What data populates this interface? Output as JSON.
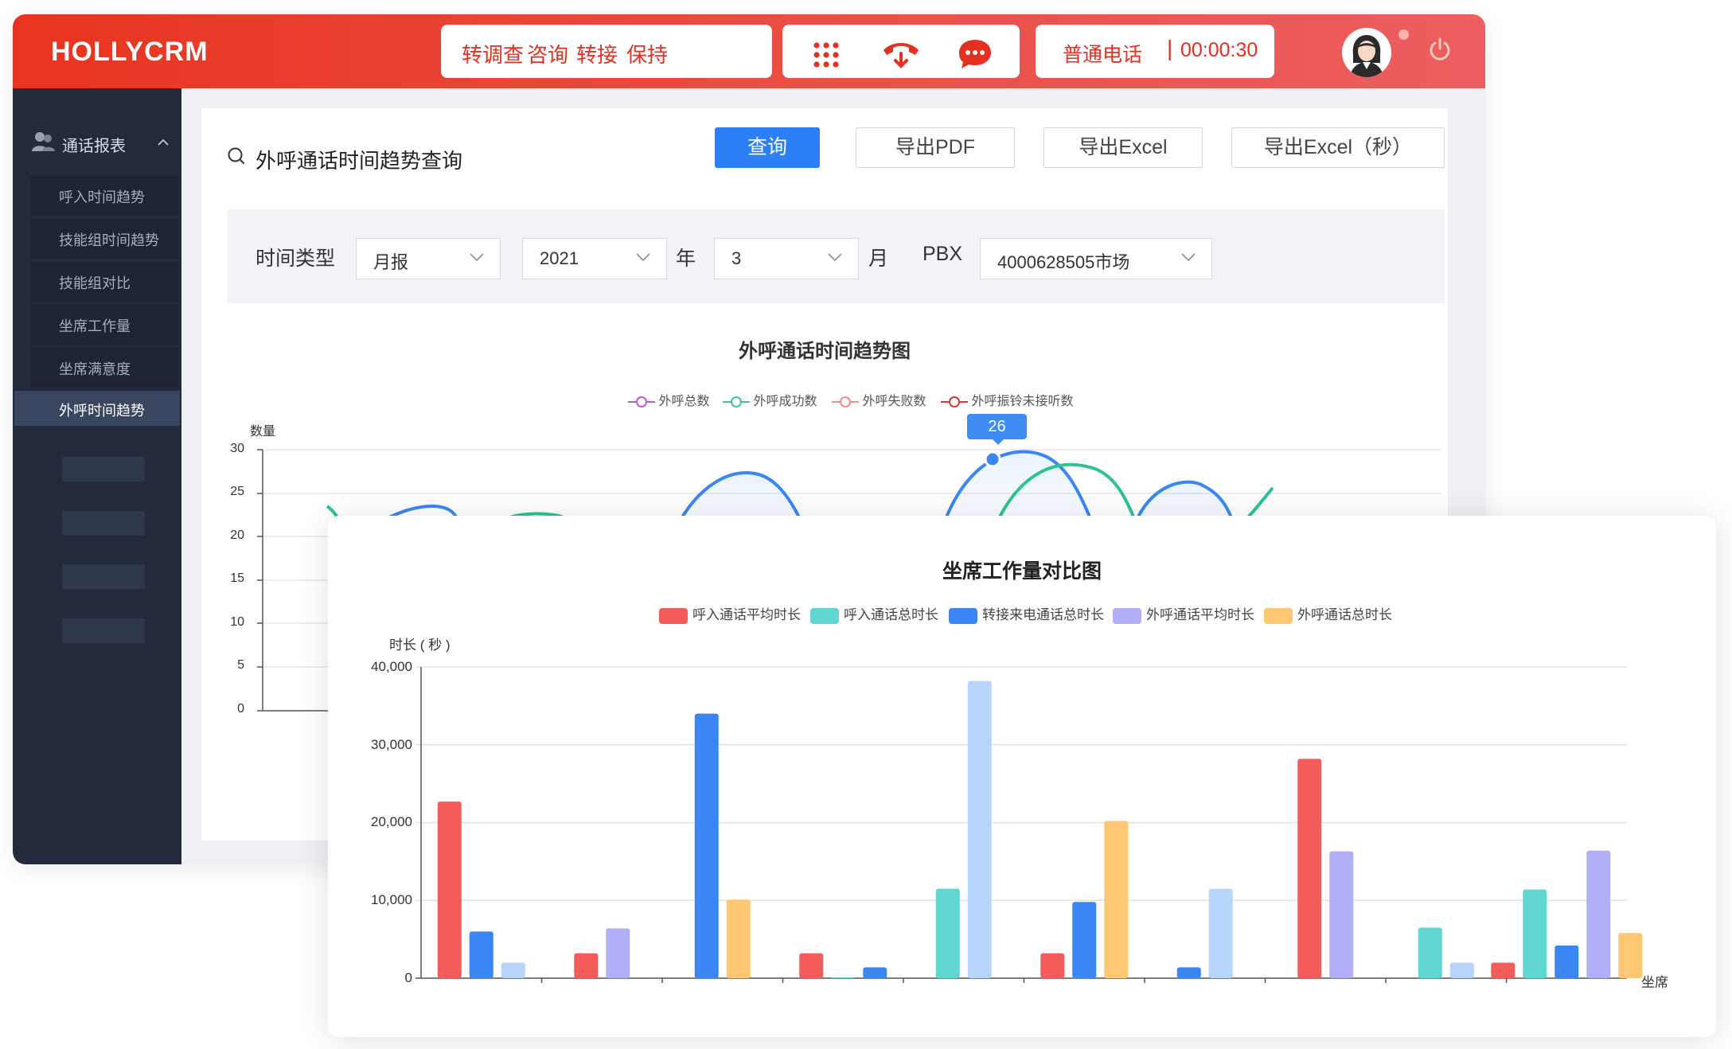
{
  "app": {
    "brand": "HOLLYCRM"
  },
  "header": {
    "call_actions": [
      "转调查",
      "咨询",
      "转接",
      "保持"
    ],
    "status": {
      "call_type": "普通电话",
      "separator": "|",
      "timer": "00:00:30"
    },
    "icons": [
      "keypad-icon",
      "hangup-icon",
      "chat-icon",
      "avatar",
      "power-icon"
    ]
  },
  "sidebar": {
    "group_label": "通话报表",
    "items": [
      "呼入时间趋势",
      "技能组时间趋势",
      "技能组对比",
      "坐席工作量",
      "坐席满意度"
    ],
    "active_item": "外呼时间趋势"
  },
  "query": {
    "title": "外呼通话时间趋势查询",
    "buttons": {
      "search": "查询",
      "pdf": "导出PDF",
      "excel": "导出Excel",
      "excel_sec": "导出Excel（秒）"
    }
  },
  "filters": {
    "time_type_label": "时间类型",
    "time_type_value": "月报",
    "year_value": "2021",
    "year_unit": "年",
    "month_value": "3",
    "month_unit": "月",
    "pbx_label": "PBX",
    "pbx_value": "4000628505市场"
  },
  "line_chart": {
    "title": "外呼通话时间趋势图",
    "ylabel": "数量",
    "legend": [
      "外呼总数",
      "外呼成功数",
      "外呼失败数",
      "外呼振铃未接听数"
    ],
    "legend_colors": [
      "#b15fd1",
      "#3dc497",
      "#f58c8c",
      "#e03535"
    ],
    "y_ticks": [
      "30",
      "25",
      "20",
      "15",
      "10",
      "5",
      "0"
    ],
    "ylim": [
      0,
      30
    ],
    "tooltip_value": "26"
  },
  "chart_data": {
    "type": "bar",
    "title": "坐席工作量对比图",
    "ylabel": "时长 ( 秒 )",
    "xlabel": "坐席",
    "ylim": [
      0,
      40000
    ],
    "y_ticks": [
      "40,000",
      "30,000",
      "20,000",
      "10,000",
      "0"
    ],
    "grid": true,
    "legend_position": "top-center",
    "categories": [
      "",
      "",
      "",
      "",
      "",
      "",
      "",
      "",
      "",
      ""
    ],
    "series": [
      {
        "name": "呼入通话平均时长",
        "color": "#f45b5b",
        "values": [
          22700,
          3200,
          0,
          3200,
          0,
          3200,
          0,
          28200,
          0,
          2000
        ]
      },
      {
        "name": "呼入通话总时长",
        "color": "#5fd6cf",
        "values": [
          0,
          0,
          0,
          100,
          11500,
          0,
          0,
          0,
          6500,
          11400
        ]
      },
      {
        "name": "转接来电通话总时长",
        "color": "#3a86f5",
        "values": [
          6000,
          0,
          34000,
          1400,
          0,
          9800,
          1400,
          0,
          0,
          4200
        ]
      },
      {
        "name": "外呼通话平均时长",
        "color": "#b3aef8",
        "values": [
          0,
          6400,
          0,
          0,
          0,
          0,
          0,
          16300,
          0,
          16400
        ]
      },
      {
        "name": "外呼通话总时长",
        "color": "#fdc774",
        "values": [
          0,
          0,
          10100,
          0,
          0,
          20200,
          0,
          0,
          0,
          5800
        ]
      },
      {
        "name": "",
        "color": "#b7d4fa",
        "values": [
          2000,
          0,
          0,
          0,
          38200,
          0,
          11500,
          0,
          2000,
          0
        ]
      }
    ]
  }
}
